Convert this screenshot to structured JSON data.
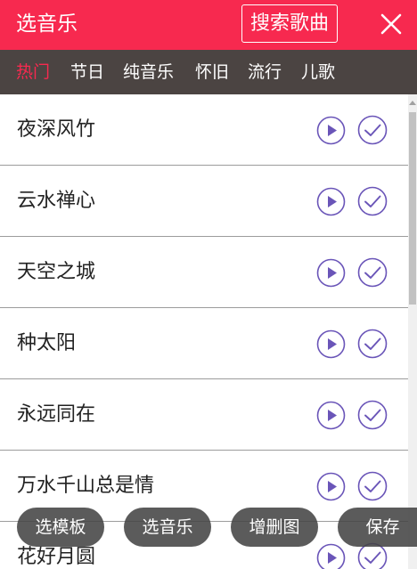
{
  "colors": {
    "brand": "#f7294f",
    "tabbar": "#4b4442",
    "icon": "#6a55b8"
  },
  "header": {
    "title": "选音乐",
    "search_label": "搜索歌曲",
    "close_icon": "close-icon"
  },
  "tabs": [
    "热门",
    "节日",
    "纯音乐",
    "怀旧",
    "流行",
    "儿歌"
  ],
  "active_tab": "热门",
  "songs": [
    "夜深风竹",
    "云水禅心",
    "天空之城",
    "种太阳",
    "永远同在",
    "万水千山总是情",
    "花好月圆"
  ],
  "bottom_bar": {
    "template_label": "选模板",
    "music_label": "选音乐",
    "edit_images_label": "增删图",
    "save_label": "保存"
  }
}
